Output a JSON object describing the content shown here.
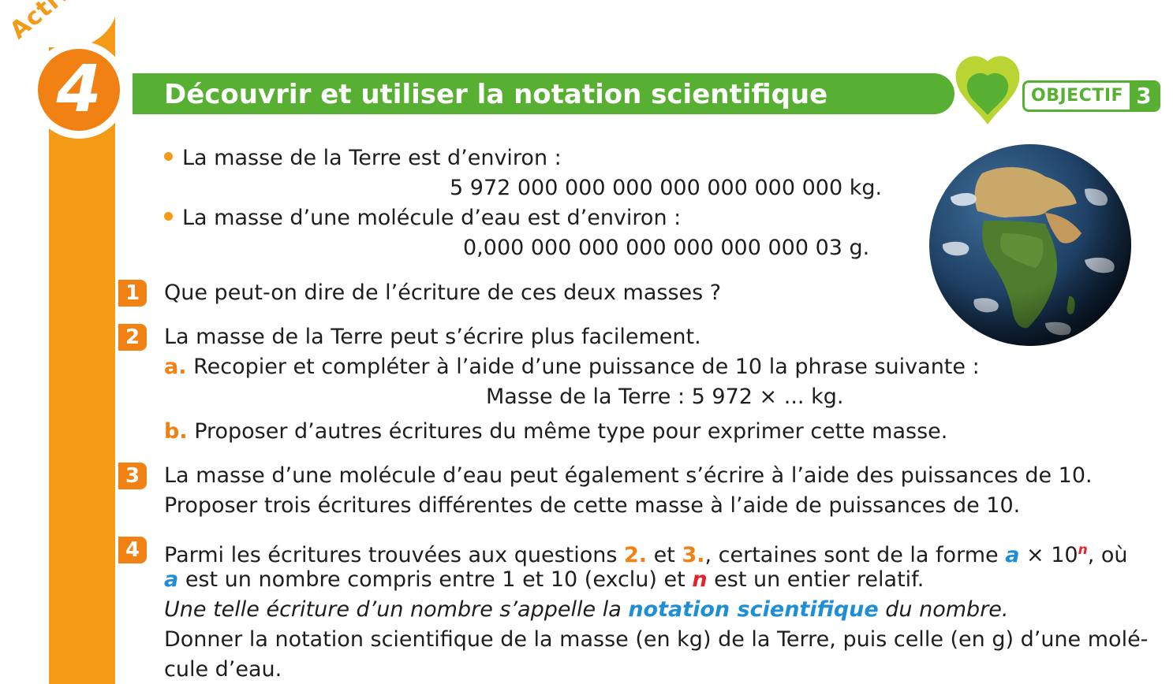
{
  "header": {
    "activite_label": "Activité",
    "activity_number": "4",
    "title": "Découvrir et utiliser la notation scientifique",
    "objectif_label": "OBJECTIF",
    "objectif_number": "3"
  },
  "intro": {
    "bullet1": "La masse de la Terre est d’environ :",
    "value1": "5 972 000 000 000 000 000 000 000 kg.",
    "bullet2": "La masse d’une molécule d’eau est d’environ :",
    "value2": "0,000 000 000 000 000 000 000 03 g."
  },
  "q1": {
    "num": "1",
    "text": "Que peut-on dire de l’écriture de ces deux masses ?"
  },
  "q2": {
    "num": "2",
    "text": "La masse de la Terre peut s’écrire plus facilement.",
    "a_letter": "a.",
    "a_text": "Recopier et compléter à l’aide d’une puissance de 10 la phrase suivante :",
    "a_formula": "Masse de la Terre : 5 972 × ... kg.",
    "b_letter": "b.",
    "b_text": "Proposer d’autres écritures du même type pour exprimer cette masse."
  },
  "q3": {
    "num": "3",
    "line1": "La masse d’une molécule d’eau peut également s’écrire à l’aide des puissances de 10.",
    "line2": "Proposer trois écritures différentes de cette masse à l’aide de puissances de 10."
  },
  "q4": {
    "num": "4",
    "l1_a": "Parmi les écritures trouvées aux questions ",
    "l1_ref2": "2.",
    "l1_b": " et ",
    "l1_ref3": "3.",
    "l1_c": ", certaines sont de la forme ",
    "var_a": "a",
    "l1_d": " × 10",
    "var_n": "n",
    "l1_e": ", où",
    "l2_b": " est un nombre compris entre 1 et 10 (exclu) et ",
    "l2_d": " est un entier relatif.",
    "l3_a": "Une telle écriture d’un nombre s’appelle la ",
    "l3_term": "notation scientifique",
    "l3_b": " du nombre.",
    "l4": "Donner la notation scientifique de la masse (en kg) de la Terre, puis celle (en g) d’une molé-",
    "l5": "cule d’eau."
  },
  "colors": {
    "orange": "#f39a16",
    "green": "#58b032",
    "blue": "#1e8fd6",
    "red": "#e4242b"
  }
}
